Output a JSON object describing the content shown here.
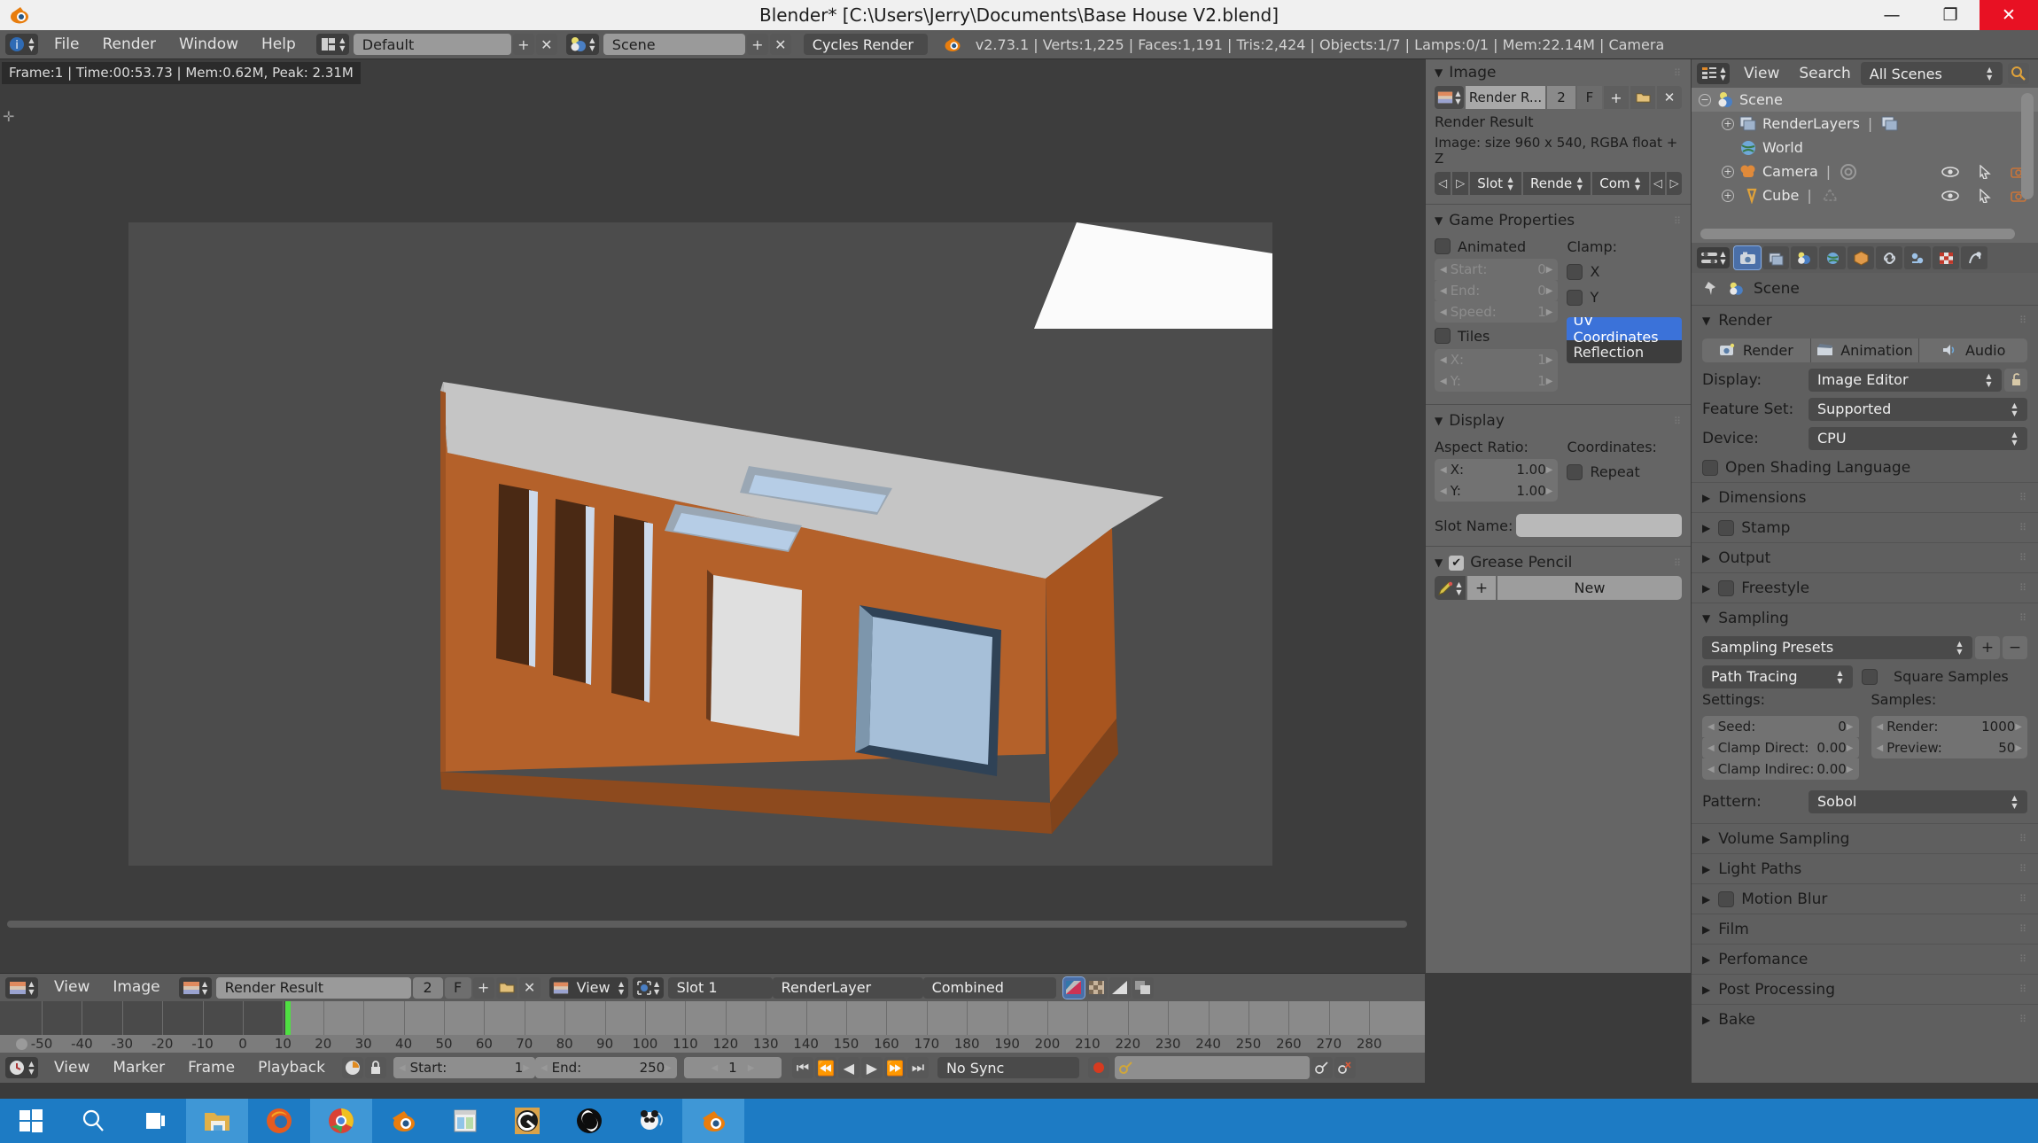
{
  "window": {
    "title": "Blender* [C:\\Users\\Jerry\\Documents\\Base House V2.blend]",
    "minimize": "—",
    "maximize": "❐",
    "close": "✕"
  },
  "info_header": {
    "editor_icon": "info-editor-icon",
    "menus": [
      "File",
      "Render",
      "Window",
      "Help"
    ],
    "screen_layout": "Default",
    "screen_add": "+",
    "screen_remove": "✕",
    "scene_name": "Scene",
    "scene_add": "+",
    "scene_remove": "✕",
    "engine": "Cycles Render",
    "stats": "v2.73.1 | Verts:1,225 | Faces:1,191 | Tris:2,424 | Objects:1/7 | Lamps:0/1 | Mem:22.14M | Camera"
  },
  "image_editor": {
    "render_stats": "Frame:1 | Time:00:53.73 | Mem:0.62M, Peak: 2.31M",
    "header": {
      "editor_icon": "image-editor-icon",
      "menus": [
        "View",
        "Image"
      ],
      "image_name": "Render Result",
      "users": "2",
      "fake_user": "F",
      "add": "+",
      "open": "open-folder-icon",
      "unlink": "✕",
      "view_mode": "View",
      "pivot_icon": "pivot-icon",
      "slot": "Slot 1",
      "layer": "RenderLayer",
      "pass": "Combined",
      "display_channels": [
        "color-and-alpha-icon",
        "alpha-icon",
        "z-buffer-icon",
        "render-icon"
      ]
    }
  },
  "image_panel": {
    "title": "Image",
    "datablock_icon": "image-data-icon",
    "name": "Render R...",
    "users": "2",
    "fake_user": "F",
    "add": "+",
    "open": "open-folder-icon",
    "unlink": "✕",
    "sub_name": "Render Result",
    "info": "Image: size 960 x 540, RGBA float + Z",
    "nav_prev": "◁",
    "nav_next": "▷",
    "slot": "Slot",
    "render": "Rende",
    "combined": "Com",
    "pass_prev": "◁",
    "pass_next": "▷"
  },
  "game_properties": {
    "title": "Game Properties",
    "animated": "Animated",
    "start_label": "Start:",
    "start_value": "0",
    "end_label": "End:",
    "end_value": "0",
    "speed_label": "Speed:",
    "speed_value": "1",
    "tiles": "Tiles",
    "tiles_x_label": "X:",
    "tiles_x_value": "1",
    "tiles_y_label": "Y:",
    "tiles_y_value": "1",
    "clamp_label": "Clamp:",
    "clamp_x": "X",
    "clamp_y": "Y",
    "mapping_selected": "UV Coordinates",
    "mapping_other": "Reflection"
  },
  "display_panel": {
    "title": "Display",
    "aspect_label": "Aspect Ratio:",
    "x_label": "X:",
    "x_value": "1.00",
    "y_label": "Y:",
    "y_value": "1.00",
    "coords_label": "Coordinates:",
    "repeat": "Repeat",
    "slot_name_label": "Slot Name:",
    "slot_name_value": ""
  },
  "grease_pencil": {
    "title": "Grease Pencil",
    "brush_icon": "pencil-icon",
    "add_icon": "+",
    "new_button": "New"
  },
  "outliner": {
    "editor_icon": "outliner-editor-icon",
    "menus": [
      "View",
      "Search"
    ],
    "display_mode": "All Scenes",
    "filter_icon": "magnifier-icon",
    "rows": [
      {
        "label": "Scene",
        "icon": "scene-icon",
        "depth": 0,
        "expander": "−",
        "selected": true,
        "extra": "",
        "toggles": false
      },
      {
        "label": "RenderLayers",
        "icon": "renderlayers-icon",
        "depth": 1,
        "expander": "+",
        "selected": false,
        "extra": "renderlayers-data-icon",
        "toggles": false
      },
      {
        "label": "World",
        "icon": "world-icon",
        "depth": 1,
        "expander": "",
        "selected": false,
        "extra": "",
        "toggles": false
      },
      {
        "label": "Camera",
        "icon": "camera-icon",
        "depth": 1,
        "expander": "+",
        "selected": false,
        "extra": "camera-data-icon",
        "toggles": true
      },
      {
        "label": "Cube",
        "icon": "mesh-icon",
        "depth": 1,
        "expander": "+",
        "selected": false,
        "extra": "mesh-data-icon",
        "toggles": true
      }
    ]
  },
  "properties": {
    "editor_icon": "properties-editor-icon",
    "tabs": [
      "render-tab",
      "renderlayers-tab",
      "scene-tab",
      "world-tab",
      "object-tab",
      "constraints-tab",
      "modifiers-tab",
      "material-tab",
      "texture-tab"
    ],
    "pin_icon": "pin-icon",
    "breadcrumb_icon": "scene-icon",
    "breadcrumb": "Scene",
    "render": {
      "title": "Render",
      "render_button": "Render",
      "animation_button": "Animation",
      "audio_button": "Audio",
      "display_label": "Display:",
      "display_value": "Image Editor",
      "lock_icon": "unlocked-icon",
      "feature_set_label": "Feature Set:",
      "feature_set_value": "Supported",
      "device_label": "Device:",
      "device_value": "CPU",
      "osl": "Open Shading Language"
    },
    "collapsed_top": [
      {
        "label": "Dimensions",
        "checkbox": false
      },
      {
        "label": "Stamp",
        "checkbox": true
      },
      {
        "label": "Output",
        "checkbox": false
      },
      {
        "label": "Freestyle",
        "checkbox": true
      }
    ],
    "sampling": {
      "title": "Sampling",
      "presets": "Sampling Presets",
      "preset_add": "+",
      "preset_remove": "−",
      "integrator": "Path Tracing",
      "square_samples": "Square Samples",
      "settings_label": "Settings:",
      "seed_label": "Seed:",
      "seed_value": "0",
      "clamp_direct_label": "Clamp Direct:",
      "clamp_direct_value": "0.00",
      "clamp_indirect_label": "Clamp Indirec:",
      "clamp_indirect_value": "0.00",
      "samples_label": "Samples:",
      "render_label": "Render:",
      "render_value": "1000",
      "preview_label": "Preview:",
      "preview_value": "50",
      "pattern_label": "Pattern:",
      "pattern_value": "Sobol"
    },
    "collapsed_bottom": [
      {
        "label": "Volume Sampling",
        "checkbox": false
      },
      {
        "label": "Light Paths",
        "checkbox": false
      },
      {
        "label": "Motion Blur",
        "checkbox": true
      },
      {
        "label": "Film",
        "checkbox": false
      },
      {
        "label": "Perfomance",
        "checkbox": false
      },
      {
        "label": "Post Processing",
        "checkbox": false
      },
      {
        "label": "Bake",
        "checkbox": false
      }
    ]
  },
  "timeline": {
    "editor_icon": "timeline-editor-icon",
    "menus": [
      "View",
      "Marker",
      "Frame",
      "Playback"
    ],
    "autokey_icon": "record-circle-icon",
    "lock_icon": "lock-icon",
    "start_label": "Start:",
    "start_value": "1",
    "end_label": "End:",
    "end_value": "250",
    "current_frame": "1",
    "transport": [
      "jump-start-icon",
      "prev-keyframe-icon",
      "play-reverse-icon",
      "play-icon",
      "next-keyframe-icon",
      "jump-end-icon"
    ],
    "sync_mode": "No Sync",
    "record_icon": "record-icon",
    "keying_set_icon": "keying-set-icon",
    "keying_set_value": "",
    "add_keyframe_icon": "add-key-icon",
    "remove_keyframe_icon": "remove-key-icon",
    "ruler_ticks": [
      -50,
      -40,
      -30,
      -20,
      -10,
      0,
      10,
      20,
      30,
      40,
      50,
      60,
      70,
      80,
      90,
      100,
      110,
      120,
      130,
      140,
      150,
      160,
      170,
      180,
      190,
      200,
      210,
      220,
      230,
      240,
      250,
      260,
      270,
      280
    ],
    "playhead_frame": 1
  },
  "taskbar": {
    "items": [
      {
        "name": "start-button",
        "icon": "windows-logo-icon",
        "active": false
      },
      {
        "name": "search-button",
        "icon": "magnifier-icon",
        "active": false
      },
      {
        "name": "task-view-button",
        "icon": "task-view-icon",
        "active": false
      },
      {
        "name": "file-explorer",
        "icon": "folder-icon",
        "active": true
      },
      {
        "name": "firefox",
        "icon": "firefox-icon",
        "active": false
      },
      {
        "name": "chrome",
        "icon": "chrome-icon",
        "active": true
      },
      {
        "name": "blender-1",
        "icon": "blender-icon",
        "active": false
      },
      {
        "name": "window-app",
        "icon": "window-icon",
        "active": false
      },
      {
        "name": "gimp",
        "icon": "g-circle-icon",
        "active": false
      },
      {
        "name": "obs",
        "icon": "obs-icon",
        "active": false
      },
      {
        "name": "panda-app",
        "icon": "panda-icon",
        "active": false
      },
      {
        "name": "blender-2",
        "icon": "blender-icon",
        "active": true
      }
    ]
  },
  "colors": {
    "accent_blue": "#3b72d9",
    "taskbar_blue": "#1d7bc4",
    "house_wall": "#b4612a",
    "house_roof": "#c3c3c3",
    "playhead_green": "#4fdf42",
    "close_red": "#e81123"
  }
}
